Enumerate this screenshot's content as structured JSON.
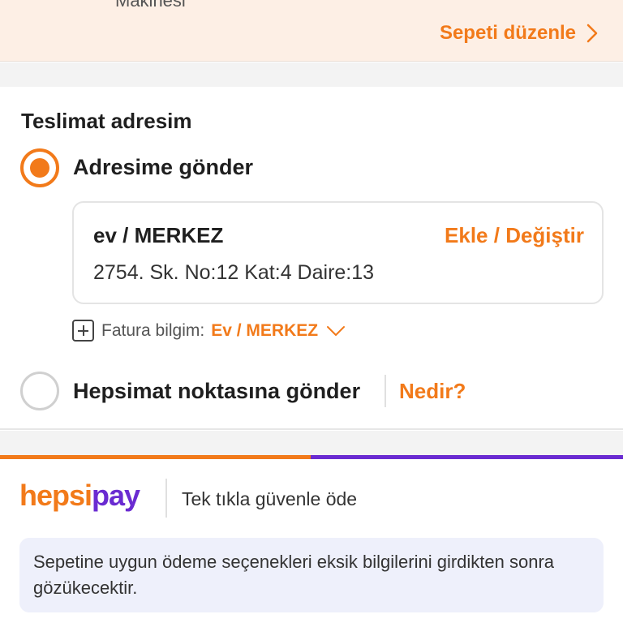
{
  "top_banner": {
    "cut_text": "Makinesi",
    "edit_cart_label": "Sepeti düzenle"
  },
  "delivery": {
    "title": "Teslimat adresim",
    "option_home_label": "Adresime gönder",
    "option_home_selected": true,
    "address": {
      "name": "ev / MERKEZ",
      "action_label": "Ekle / Değiştir",
      "line": "2754. Sk. No:12 Kat:4 Daire:13"
    },
    "invoice": {
      "label": "Fatura bilgim:",
      "value": "Ev / MERKEZ"
    },
    "option_pickup_label": "Hepsimat noktasına gönder",
    "option_pickup_selected": false,
    "what_link_label": "Nedir?"
  },
  "payment": {
    "logo_hepsi": "hepsi",
    "logo_pay": "pay",
    "tagline": "Tek tıkla güvenle öde",
    "info_text": "Sepetine uygun ödeme seçenekleri eksik bilgilerini girdikten sonra gözükecektir."
  },
  "colors": {
    "accent": "#f27a1a",
    "pay_purple": "#6a2bd1",
    "banner_bg": "#fdefe5",
    "info_bg": "#eef0fb"
  },
  "icons": [
    "chevron-right-icon",
    "plus-square-icon",
    "chevron-down-icon"
  ]
}
